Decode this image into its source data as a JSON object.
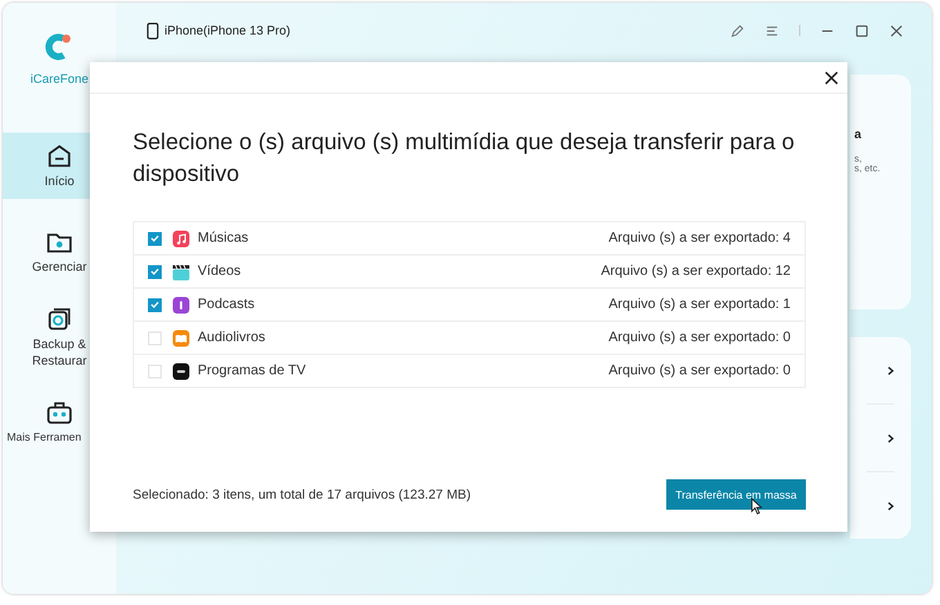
{
  "app": {
    "name": "iCareFone"
  },
  "sidebar": {
    "items": [
      {
        "label": "Início",
        "kind": "home",
        "selected": true
      },
      {
        "label": "Gerenciar",
        "kind": "manage",
        "selected": false
      },
      {
        "label": "Backup & Restaurar",
        "kind": "backup",
        "selected": false
      },
      {
        "label": "Mais Ferramen",
        "kind": "tools",
        "selected": false
      }
    ]
  },
  "device": {
    "title": "iPhone(iPhone 13 Pro)"
  },
  "background": {
    "card_fragments": [
      {
        "text": "a",
        "kind": "heading"
      },
      {
        "text": "s,",
        "kind": "line"
      },
      {
        "text": "s, etc.",
        "kind": "line"
      }
    ],
    "link_rows": [
      {
        "kind": "link"
      },
      {
        "kind": "link"
      },
      {
        "kind": "link"
      }
    ]
  },
  "dialog": {
    "title": "Selecione o (s) arquivo (s) multimídia que deseja transferir para o dispositivo",
    "items": [
      {
        "label": "Músicas",
        "kind": "music",
        "checked": true,
        "count": "Arquivo (s) a ser exportado: 4"
      },
      {
        "label": "Vídeos",
        "kind": "video",
        "checked": true,
        "count": "Arquivo (s) a ser exportado: 12"
      },
      {
        "label": "Podcasts",
        "kind": "podcast",
        "checked": true,
        "count": "Arquivo (s) a ser exportado: 1"
      },
      {
        "label": "Audiolivros",
        "kind": "book",
        "checked": false,
        "count": "Arquivo (s) a ser exportado: 0"
      },
      {
        "label": "Programas de TV",
        "kind": "tv",
        "checked": false,
        "count": "Arquivo (s) a ser exportado: 0"
      }
    ],
    "summary": "Selecionado: 3 itens, um total de 17 arquivos (123.27 MB)",
    "button": "Transferência em massa"
  }
}
